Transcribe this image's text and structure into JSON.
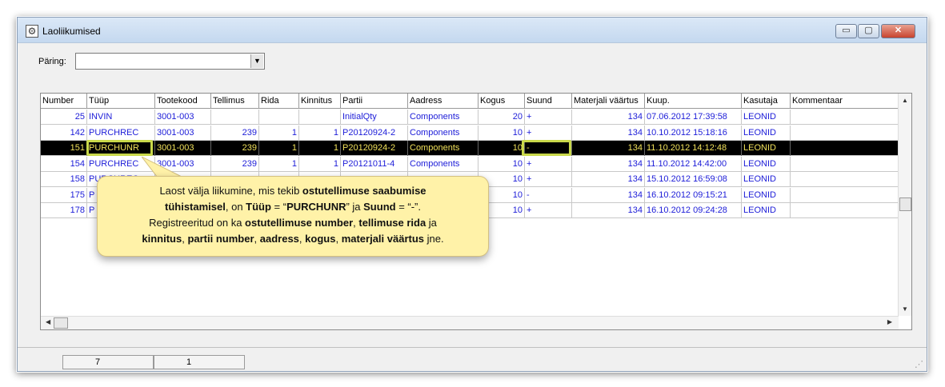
{
  "window": {
    "title": "Laoliikumised",
    "minimize_glyph": "▭",
    "maximize_glyph": "▢",
    "close_glyph": "✕"
  },
  "query": {
    "label": "Päring:",
    "value": ""
  },
  "table": {
    "columns": [
      "Number",
      "Tüüp",
      "Tootekood",
      "Tellimus",
      "Rida",
      "Kinnitus",
      "Partii",
      "Aadress",
      "Kogus",
      "Suund",
      "Materjali väärtus",
      "Kuup.",
      "Kasutaja",
      "Kommentaar"
    ],
    "rows": [
      [
        "25",
        "INVIN",
        "3001-003",
        "",
        "",
        "",
        "InitialQty",
        "Components",
        "20",
        "+",
        "134",
        "07.06.2012 17:39:58",
        "LEONID",
        ""
      ],
      [
        "142",
        "PURCHREC",
        "3001-003",
        "239",
        "1",
        "1",
        "P20120924-2",
        "Components",
        "10",
        "+",
        "134",
        "10.10.2012 15:18:16",
        "LEONID",
        ""
      ],
      [
        "151",
        "PURCHUNR",
        "3001-003",
        "239",
        "1",
        "1",
        "P20120924-2",
        "Components",
        "10",
        "-",
        "134",
        "11.10.2012 14:12:48",
        "LEONID",
        ""
      ],
      [
        "154",
        "PURCHREC",
        "3001-003",
        "239",
        "1",
        "1",
        "P20121011-4",
        "Components",
        "10",
        "+",
        "134",
        "11.10.2012 14:42:00",
        "LEONID",
        ""
      ],
      [
        "158",
        "PURCHREC",
        "",
        "",
        "",
        "",
        "",
        "",
        "10",
        "+",
        "134",
        "15.10.2012 16:59:08",
        "LEONID",
        ""
      ],
      [
        "175",
        "P",
        "",
        "",
        "",
        "",
        "",
        "",
        "10",
        "-",
        "134",
        "16.10.2012 09:15:21",
        "LEONID",
        ""
      ],
      [
        "178",
        "P",
        "",
        "",
        "",
        "",
        "",
        "",
        "10",
        "+",
        "134",
        "16.10.2012 09:24:28",
        "LEONID",
        ""
      ]
    ],
    "selected_row": 2,
    "highlight_color": "#c9d84a",
    "row_text_color": "#1c1cd8",
    "selected_text_color": "#f1e15a"
  },
  "callout": {
    "line1_a": "Laost välja liikumine, mis tekib ",
    "line1_b": "ostutellimuse saabumise",
    "line2_a": "tühistamisel",
    "line2_b": ", on ",
    "line2_c": "Tüüp",
    "line2_d": " = “",
    "line2_e": "PURCHUNR",
    "line2_f": "” ja ",
    "line2_g": "Suund",
    "line2_h": " = “-”.",
    "line3_a": "Registreeritud on ka ",
    "line3_b": "ostutellimuse number",
    "line3_c": ", ",
    "line3_d": "tellimuse rida",
    "line3_e": " ja",
    "line4_a": "kinnitus",
    "line4_b": ", ",
    "line4_c": "partii number",
    "line4_d": ", ",
    "line4_e": "aadress",
    "line4_f": ", ",
    "line4_g": "kogus",
    "line4_h": ", ",
    "line4_i": "materjali väärtus",
    "line4_j": " jne.",
    "background": "#fff2a8"
  },
  "status": {
    "panel1": "7",
    "panel2": "1"
  }
}
